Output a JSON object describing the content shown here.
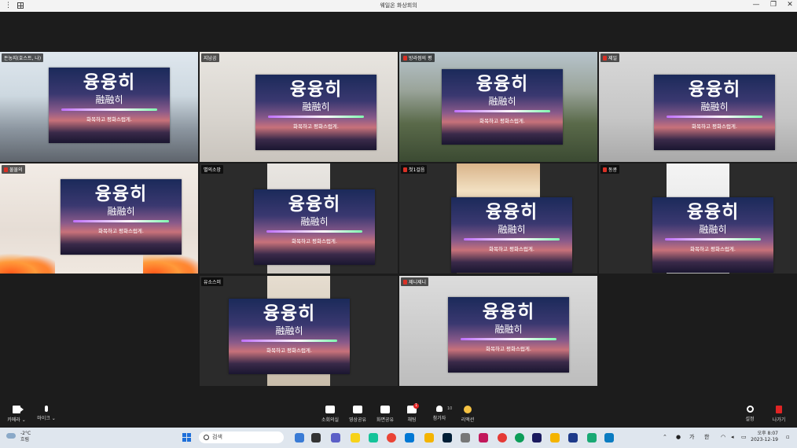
{
  "window": {
    "title": "웨일온 화상회의"
  },
  "overlay": {
    "main": "융융히",
    "sub": "融融히",
    "caption": "화목하고 평화스럽게."
  },
  "participants": [
    {
      "name": "돈농지(호스트, 나)"
    },
    {
      "name": "지남곰"
    },
    {
      "name": "방라점의 평"
    },
    {
      "name": "제일"
    },
    {
      "name": "물물의"
    },
    {
      "name": "별의소망"
    },
    {
      "name": "첫1걸음"
    },
    {
      "name": "동콩"
    },
    {
      "name": "유소스미"
    },
    {
      "name": "제니제니"
    }
  ],
  "toolbar": {
    "camera": "카메라",
    "mic": "마이크",
    "meeting_info": "소회의실",
    "video_share": "영상공유",
    "screen_share": "화면공유",
    "chat": "채팅",
    "chat_badge": "1",
    "participants": "참가자",
    "participant_count": "10",
    "reaction": "리액션",
    "settings": "설정",
    "leave": "나가기"
  },
  "taskbar": {
    "temp": "-2°C",
    "weather": "흐림",
    "search_placeholder": "검색",
    "ime_1": "가",
    "ime_2": "한",
    "time": "오후 8:07",
    "date": "2023-12-19"
  }
}
